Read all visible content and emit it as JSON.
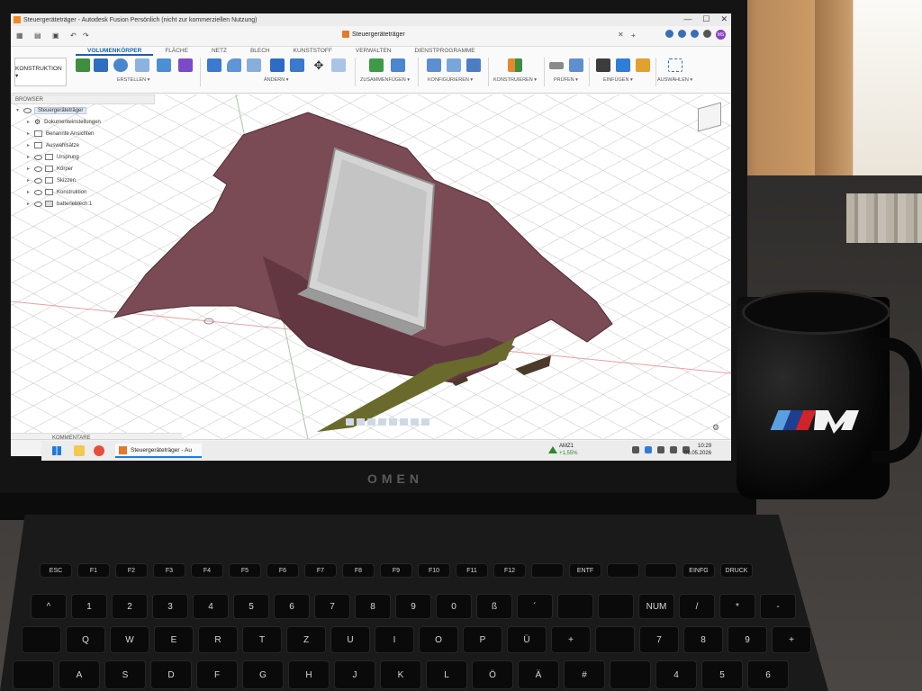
{
  "window": {
    "title": "Steuergeräteträger - Autodesk Fusion Persönlich (nicht zur kommerziellen Nutzung)",
    "controls": [
      "—",
      "☐",
      "✕"
    ]
  },
  "document_tab": {
    "name": "Steuergeräteträger",
    "close": "✕",
    "new_tab": "+"
  },
  "account": {
    "avatar_initials": "MS"
  },
  "ribbon": {
    "workspace": "KONSTRUKTION ▾",
    "tabs": [
      "VOLUMENKÖRPER",
      "FLÄCHE",
      "NETZ",
      "BLECH",
      "KUNSTSTOFF",
      "VERWALTEN",
      "DIENSTPROGRAMME"
    ],
    "active_tab": "VOLUMENKÖRPER",
    "groups": [
      "ERSTELLEN ▾",
      "ÄNDERN ▾",
      "ZUSAMMENFÜGEN ▾",
      "KONFIGURIEREN ▾",
      "KONSTRUIEREN ▾",
      "PRÜFEN ▾",
      "EINFÜGEN ▾",
      "AUSWÄHLEN ▾"
    ]
  },
  "browser": {
    "header": "BROWSER",
    "root": "Steuergeräteträger",
    "items": [
      {
        "label": "Dokumenteinstellungen",
        "icon": "gear-icon"
      },
      {
        "label": "Benannte Ansichten",
        "icon": "folder-icon"
      },
      {
        "label": "Auswahlsätze",
        "icon": "folder-icon"
      },
      {
        "label": "Ursprung",
        "icon": "folder-icon"
      },
      {
        "label": "Körper",
        "icon": "folder-icon"
      },
      {
        "label": "Skizzen",
        "icon": "folder-icon"
      },
      {
        "label": "Konstruktion",
        "icon": "folder-icon"
      },
      {
        "label": "batterieblech:1",
        "icon": "component-icon"
      }
    ]
  },
  "comments": {
    "label": "KOMMENTARE"
  },
  "taskbar": {
    "app_label": "Steuergeräteträger - Au",
    "stock_symbol": "AMZ1",
    "stock_change": "+1,55%",
    "time": "10:29",
    "date": "06.05.2026"
  },
  "keyboard": {
    "fn_row": [
      "ESC",
      "F1",
      "F2",
      "F3",
      "F4",
      "F5",
      "F6",
      "F7",
      "F8",
      "F9",
      "F10",
      "F11",
      "F12",
      "",
      "ENTF",
      "",
      "",
      "EINFG",
      "DRUCK"
    ],
    "num_row": [
      "^",
      "1",
      "2",
      "3",
      "4",
      "5",
      "6",
      "7",
      "8",
      "9",
      "0",
      "ß",
      "´",
      "",
      "",
      "NUM",
      "/",
      "*",
      "-"
    ],
    "qwertz_row": [
      "",
      "Q",
      "W",
      "E",
      "R",
      "T",
      "Z",
      "U",
      "I",
      "O",
      "P",
      "Ü",
      "+",
      "",
      "7",
      "8",
      "9",
      "+"
    ],
    "asdf_row": [
      "",
      "A",
      "S",
      "D",
      "F",
      "G",
      "H",
      "J",
      "K",
      "L",
      "Ö",
      "Ä",
      "#",
      "",
      "4",
      "5",
      "6"
    ]
  },
  "device": {
    "brand": "OMEN"
  },
  "colors": {
    "accent": "#1a5fb4",
    "mesh": "#7a4a55",
    "plate": "#cfcfcf",
    "timeline_marker": "#e6892c"
  }
}
